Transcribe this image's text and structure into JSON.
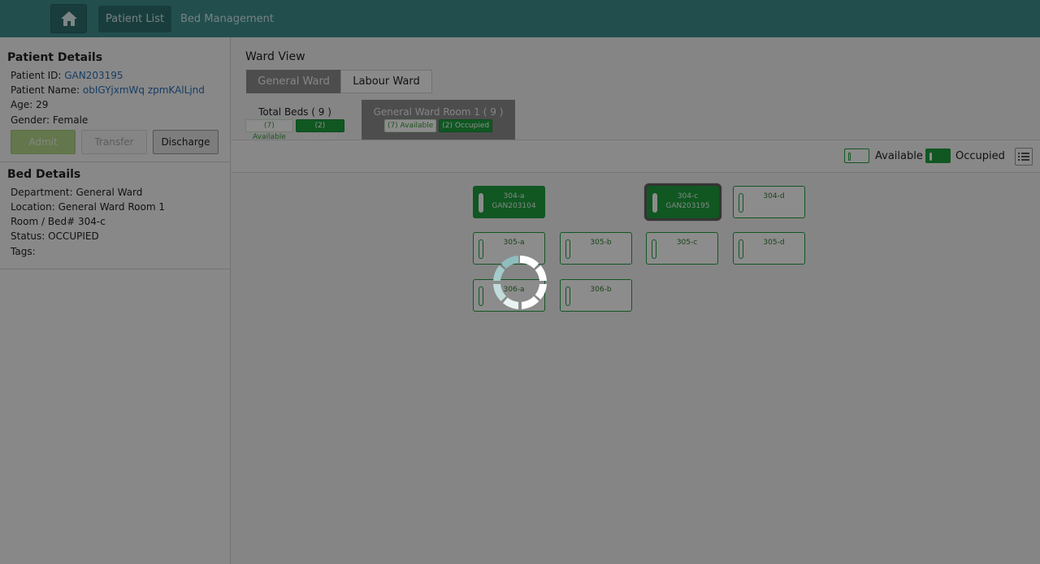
{
  "nav": {
    "home_icon": "home-icon",
    "tabs": [
      {
        "label": "Patient List",
        "active": true
      },
      {
        "label": "Bed Management",
        "active": false
      }
    ]
  },
  "patient": {
    "title": "Patient Details",
    "id_label": "Patient ID:",
    "id_value": "GAN203195",
    "name_label": "Patient Name:",
    "name_value": "obIGYjxmWq zpmKAlLjnd",
    "age_label": "Age:",
    "age_value": "29",
    "gender_label": "Gender:",
    "gender_value": "Female",
    "buttons": {
      "admit": "Admit",
      "transfer": "Transfer",
      "discharge": "Discharge"
    }
  },
  "bed_details": {
    "title": "Bed Details",
    "department_label": "Department:",
    "department_value": "General Ward",
    "location_label": "Location:",
    "location_value": "General Ward Room 1",
    "room_label": "Room / Bed#",
    "room_value": "304-c",
    "status_label": "Status:",
    "status_value": "OCCUPIED",
    "tags_label": "Tags:"
  },
  "ward_view": {
    "title": "Ward View",
    "tabs": [
      {
        "label": "General Ward",
        "active": true
      },
      {
        "label": "Labour Ward",
        "active": false
      }
    ],
    "rooms": [
      {
        "name": "Total Beds ( 9 )",
        "available": "(7) Available",
        "occupied": "(2) Occupied",
        "active": false
      },
      {
        "name": "General Ward Room 1 ( 9 )",
        "available": "(7) Available",
        "occupied": "(2) Occupied",
        "active": true
      }
    ],
    "legend": {
      "available": "Available",
      "occupied": "Occupied"
    },
    "beds": [
      {
        "id": "304-a",
        "patient": "GAN203104",
        "status": "occupied",
        "selected": false
      },
      {
        "id": "304-c",
        "patient": "GAN203195",
        "status": "occupied",
        "selected": true
      },
      {
        "id": "304-d",
        "patient": "",
        "status": "available",
        "selected": false
      },
      {
        "id": "305-a",
        "patient": "",
        "status": "available",
        "selected": false
      },
      {
        "id": "305-b",
        "patient": "",
        "status": "available",
        "selected": false
      },
      {
        "id": "305-c",
        "patient": "",
        "status": "available",
        "selected": false
      },
      {
        "id": "305-d",
        "patient": "",
        "status": "available",
        "selected": false
      },
      {
        "id": "306-a",
        "patient": "",
        "status": "available",
        "selected": false
      },
      {
        "id": "306-b",
        "patient": "",
        "status": "available",
        "selected": false
      }
    ]
  },
  "colors": {
    "topbar": "#3f8e8e",
    "occupied": "#1e9e3e",
    "link": "#2a6fb8"
  },
  "overlay": {
    "loading": true
  }
}
